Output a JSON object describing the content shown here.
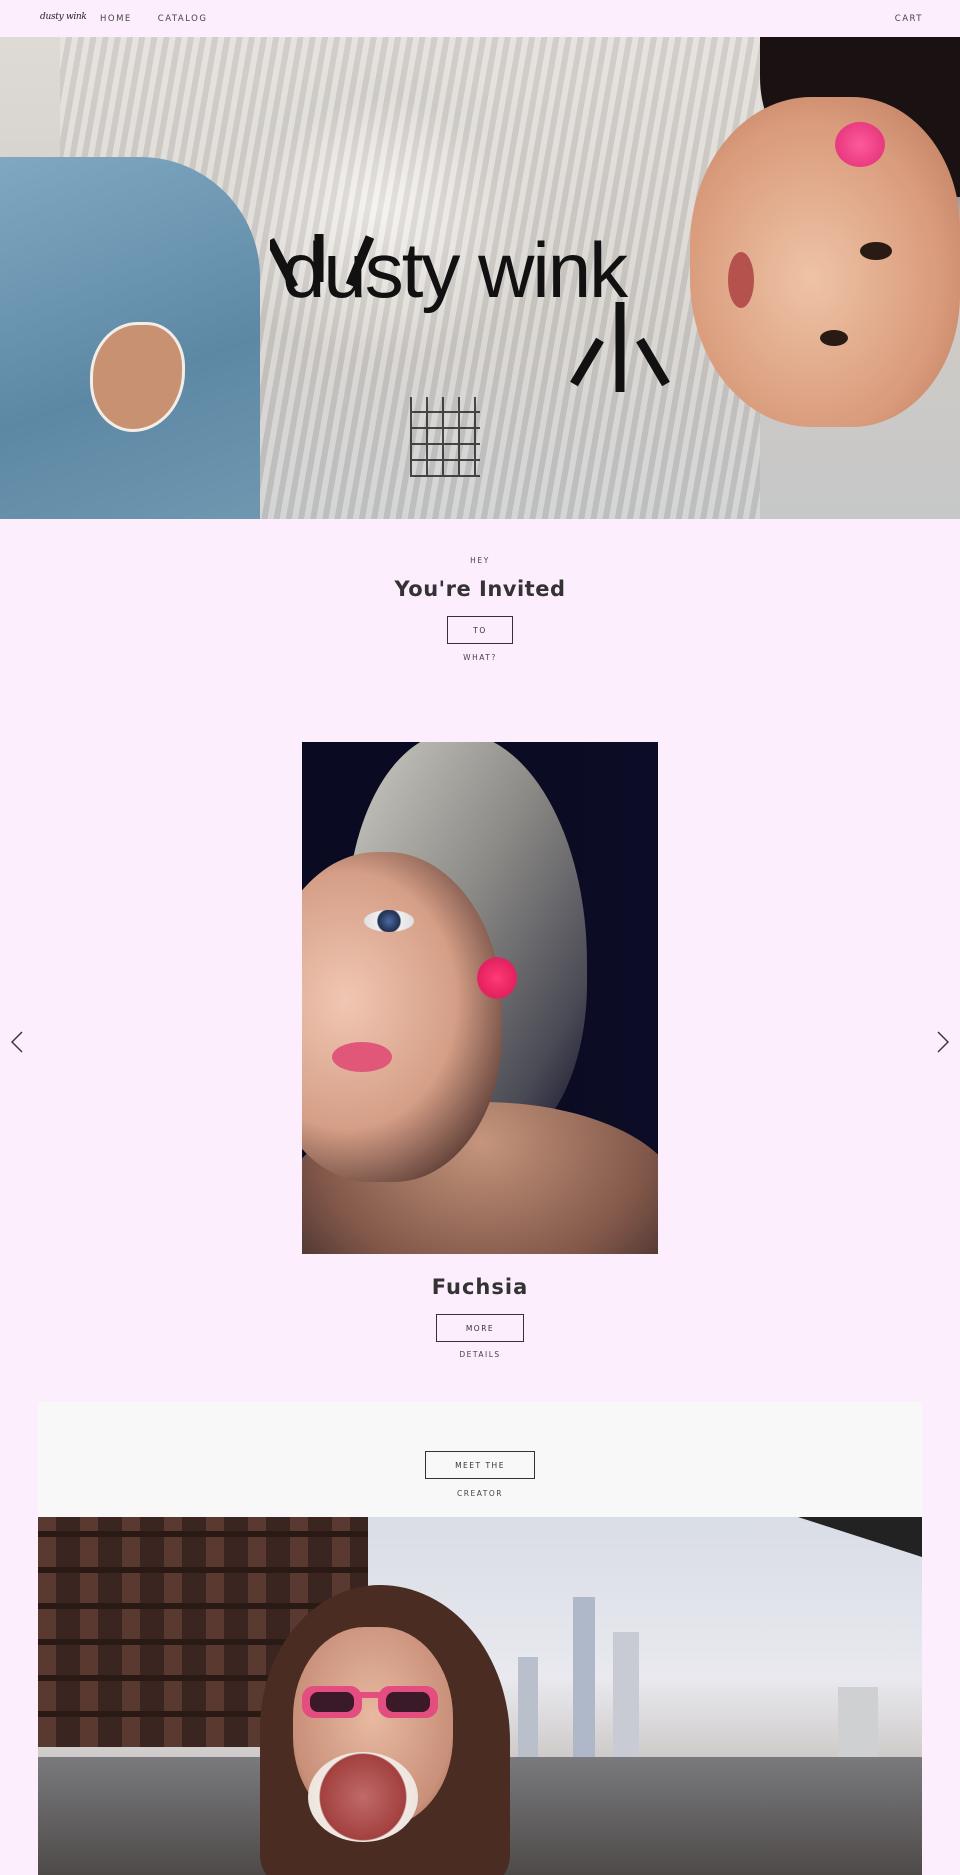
{
  "header": {
    "logo": "dusty wink",
    "nav": [
      {
        "label": "HOME"
      },
      {
        "label": "CATALOG"
      }
    ],
    "cart_label": "CART"
  },
  "hero": {
    "brand": "dusty wink"
  },
  "invite": {
    "kicker": "HEY",
    "title": "You're Invited",
    "button_label": "TO",
    "subtext": "WHAT?"
  },
  "slideshow": {
    "prev_icon": "chevron-left-icon",
    "next_icon": "chevron-right-icon",
    "title": "Fuchsia",
    "button_label": "MORE",
    "subtext": "DETAILS"
  },
  "creator": {
    "button_label": "MEET THE",
    "subtext": "CREATOR"
  },
  "colors": {
    "background": "#fdeefd",
    "text": "#333333",
    "panel": "#f8f8f8"
  }
}
